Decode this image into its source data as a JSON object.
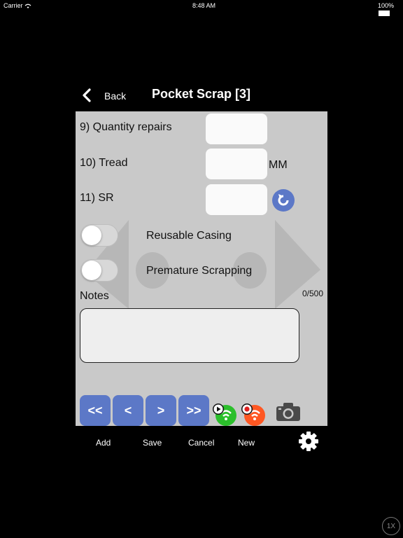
{
  "status_bar": {
    "carrier": "Carrier",
    "time": "8:48 AM",
    "battery": "100%"
  },
  "nav": {
    "back_label": "Back",
    "title": "Pocket Scrap [3]"
  },
  "form": {
    "q9_label": "9) Quantity repairs",
    "q10_label": "10) Tread",
    "q10_unit": "MM",
    "q11_label": "11) SR",
    "reusable_casing_label": "Reusable Casing",
    "premature_scrapping_label": "Premature Scrapping",
    "notes_label": "Notes",
    "notes_counter": "0/500"
  },
  "pager": {
    "first": "<<",
    "prev": "<",
    "next": ">",
    "last": ">>"
  },
  "toolbar": {
    "add": "Add",
    "save": "Save",
    "cancel": "Cancel",
    "new": "New"
  },
  "zoom_badge": "1X",
  "colors": {
    "accent": "#5c78c7",
    "green": "#2bbf2b",
    "orange": "#ff5722",
    "panel": "#c9c9c9"
  },
  "icons": [
    "chevron-left-icon",
    "refresh-icon",
    "wifi-play-icon",
    "wifi-record-icon",
    "camera-icon",
    "gear-icon"
  ]
}
